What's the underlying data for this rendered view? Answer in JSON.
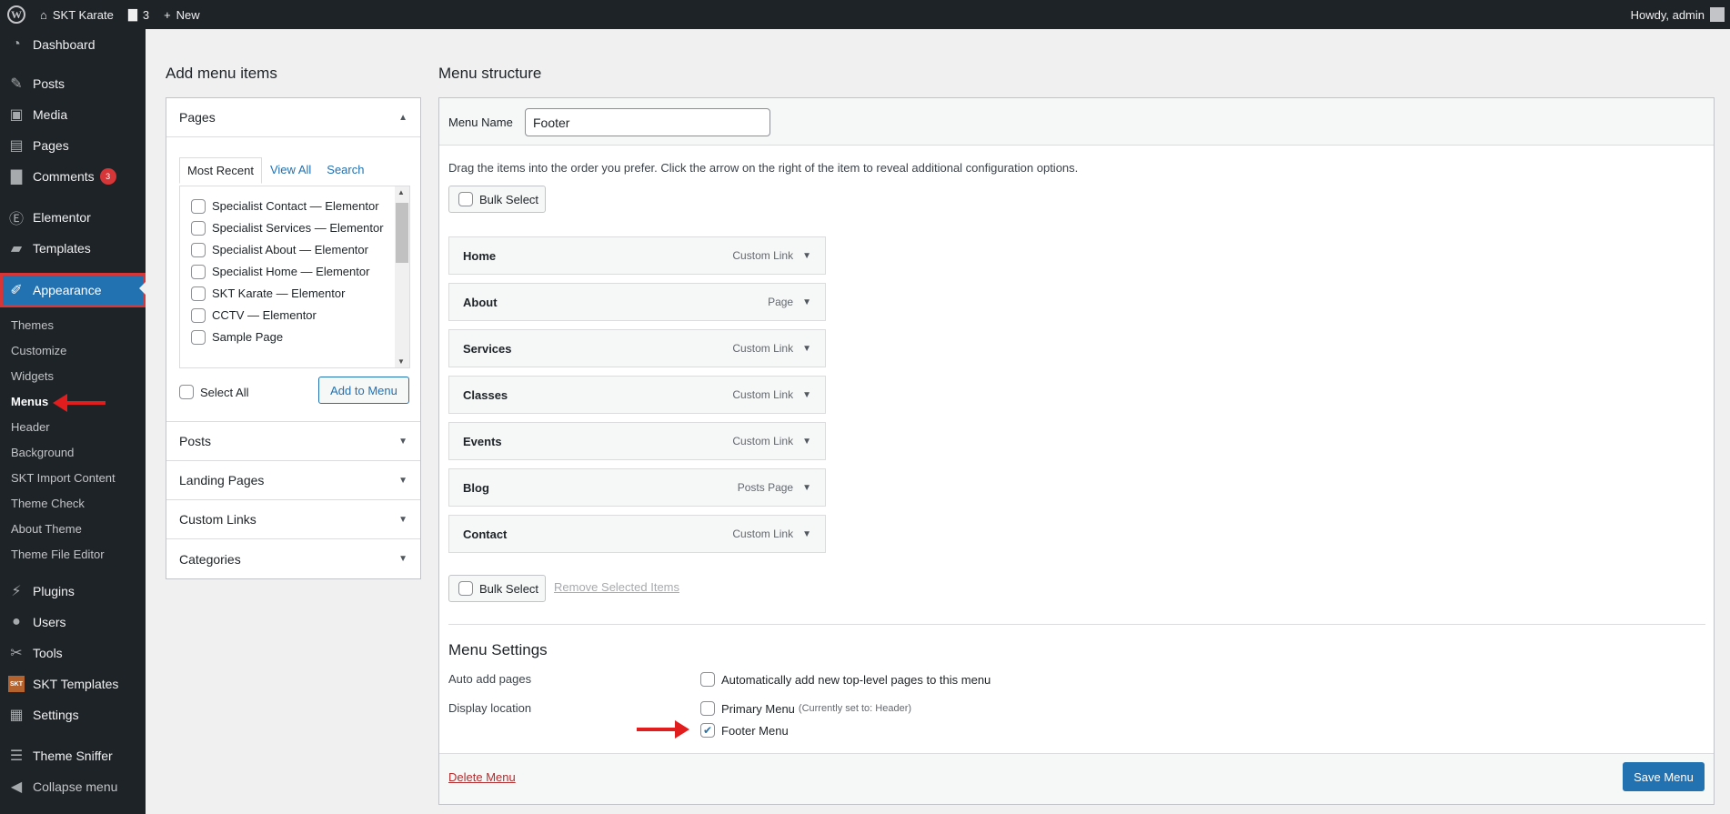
{
  "adminbar": {
    "site_name": "SKT Karate",
    "comments_count": "3",
    "new_label": "New",
    "howdy": "Howdy, admin"
  },
  "sidebar": {
    "dashboard": "Dashboard",
    "posts": "Posts",
    "media": "Media",
    "pages": "Pages",
    "comments": "Comments",
    "comments_badge": "3",
    "elementor": "Elementor",
    "templates": "Templates",
    "appearance": "Appearance",
    "sub": [
      "Themes",
      "Customize",
      "Widgets",
      "Menus",
      "Header",
      "Background",
      "SKT Import Content",
      "Theme Check",
      "About Theme",
      "Theme File Editor"
    ],
    "plugins": "Plugins",
    "users": "Users",
    "tools": "Tools",
    "skt_templates": "SKT Templates",
    "skt_logo_text": "SKT",
    "settings": "Settings",
    "theme_sniffer": "Theme Sniffer",
    "collapse": "Collapse menu"
  },
  "add_items": {
    "title": "Add menu items",
    "pages_label": "Pages",
    "tabs": [
      "Most Recent",
      "View All",
      "Search"
    ],
    "page_list": [
      "Specialist Contact — Elementor",
      "Specialist Services — Elementor",
      "Specialist About — Elementor",
      "Specialist Home — Elementor",
      "SKT Karate — Elementor",
      "CCTV — Elementor",
      "Sample Page"
    ],
    "select_all": "Select All",
    "add_button": "Add to Menu",
    "sections": [
      "Posts",
      "Landing Pages",
      "Custom Links",
      "Categories"
    ]
  },
  "menu_structure": {
    "title": "Menu structure",
    "name_label": "Menu Name",
    "name_value": "Footer",
    "instructions": "Drag the items into the order you prefer. Click the arrow on the right of the item to reveal additional configuration options.",
    "bulk_select": "Bulk Select",
    "items": [
      {
        "title": "Home",
        "type": "Custom Link"
      },
      {
        "title": "About",
        "type": "Page"
      },
      {
        "title": "Services",
        "type": "Custom Link"
      },
      {
        "title": "Classes",
        "type": "Custom Link"
      },
      {
        "title": "Events",
        "type": "Custom Link"
      },
      {
        "title": "Blog",
        "type": "Posts Page"
      },
      {
        "title": "Contact",
        "type": "Custom Link"
      }
    ],
    "remove_selected": "Remove Selected Items",
    "settings_title": "Menu Settings",
    "auto_add_label": "Auto add pages",
    "auto_add_option": "Automatically add new top-level pages to this menu",
    "display_location_label": "Display location",
    "primary_menu": "Primary Menu",
    "primary_note": "(Currently set to: Header)",
    "footer_menu": "Footer Menu",
    "delete_menu": "Delete Menu",
    "save_menu": "Save Menu"
  },
  "colors": {
    "admin_dark": "#1d2327",
    "accent_blue": "#2271b1",
    "annotation_red": "#e21d1d"
  }
}
